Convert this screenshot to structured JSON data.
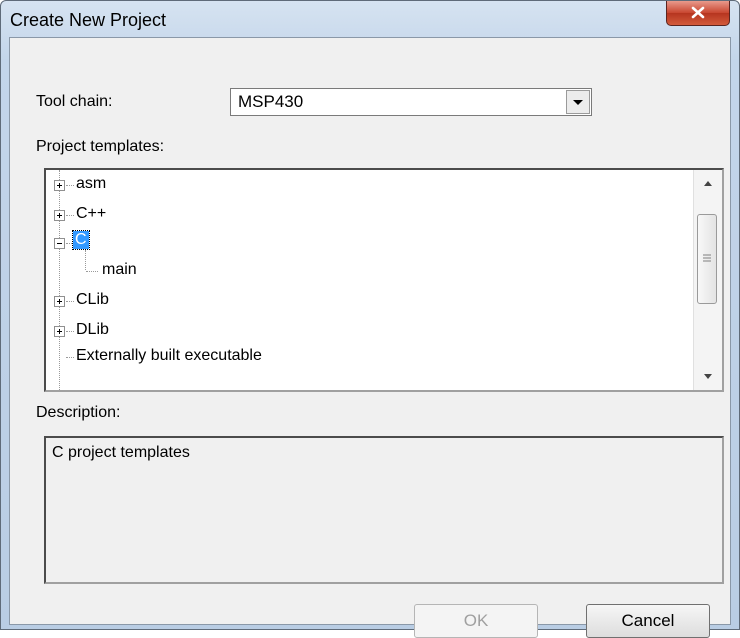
{
  "window": {
    "title": "Create New Project"
  },
  "toolchain": {
    "label": "Tool chain:",
    "value": "MSP430"
  },
  "templates": {
    "label": "Project templates:",
    "items": [
      {
        "label": "asm",
        "expander": "+"
      },
      {
        "label": "C++",
        "expander": "+"
      },
      {
        "label": "C",
        "expander": "-",
        "selected": true
      },
      {
        "label": "main",
        "child": true
      },
      {
        "label": "CLib",
        "expander": "+"
      },
      {
        "label": "DLib",
        "expander": "+"
      },
      {
        "label": "Externally built executable",
        "partial": true
      }
    ]
  },
  "description": {
    "label": "Description:",
    "text": "C project templates"
  },
  "buttons": {
    "ok": "OK",
    "cancel": "Cancel"
  },
  "icons": {
    "close": "close-icon",
    "dropdown": "dropdown-arrow-icon",
    "scroll_up": "scroll-up-arrow-icon",
    "scroll_down": "scroll-down-arrow-icon"
  },
  "colors": {
    "selection": "#3399ff",
    "close_button": "#c8452f"
  }
}
